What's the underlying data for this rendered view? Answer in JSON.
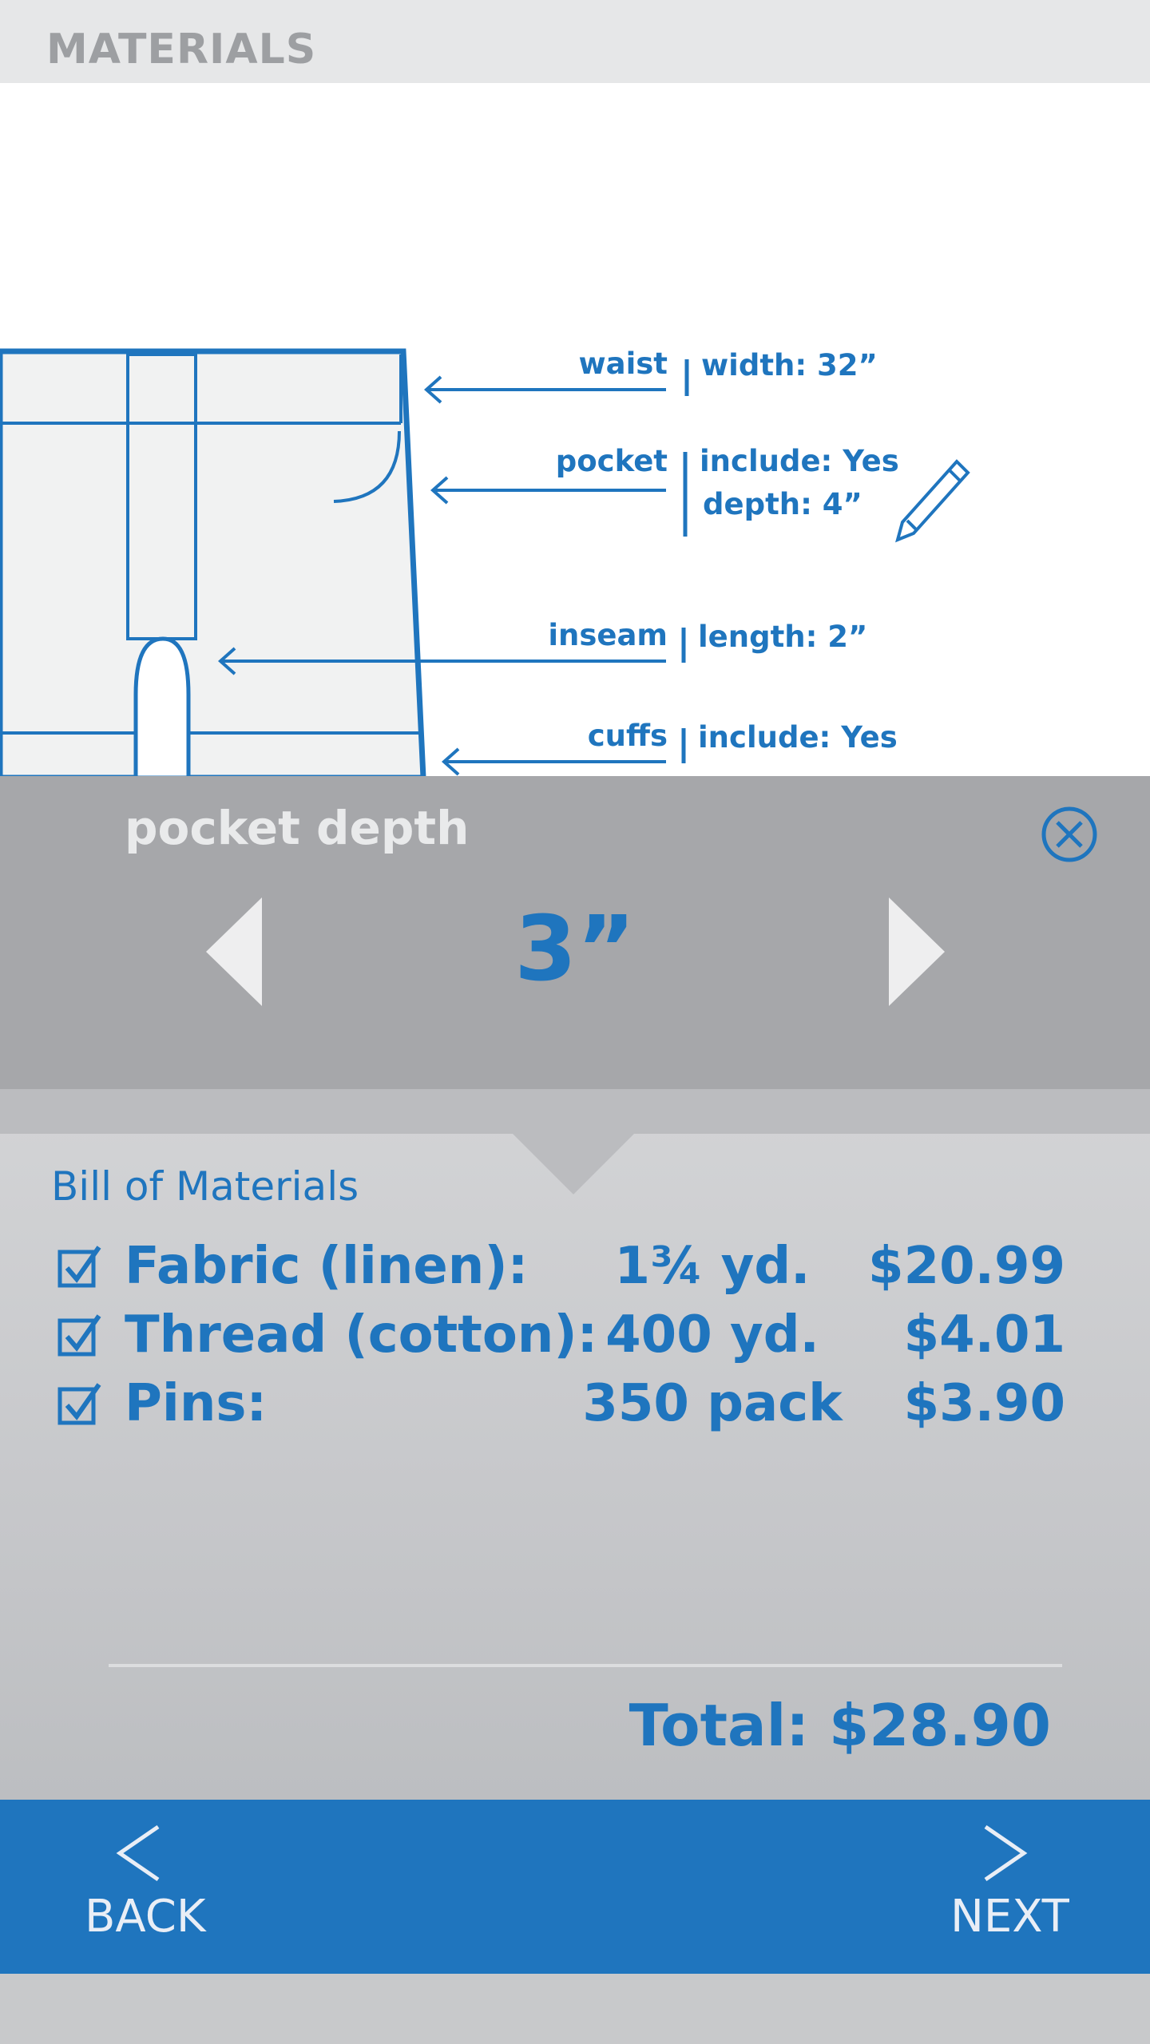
{
  "header": {
    "title": "MATERIALS"
  },
  "diagram": {
    "callouts": [
      {
        "name": "waist",
        "details": [
          "width: 32”"
        ]
      },
      {
        "name": "pocket",
        "details": [
          "include: Yes",
          "depth: 4”"
        ]
      },
      {
        "name": "inseam",
        "details": [
          "length: 2”"
        ]
      },
      {
        "name": "cuffs",
        "details": [
          "include: Yes"
        ]
      }
    ]
  },
  "picker": {
    "title": "pocket depth",
    "value": "3”"
  },
  "bill": {
    "title": "Bill of Materials",
    "items": [
      {
        "name": "Fabric (linen):",
        "qty": "1¾ yd.",
        "price": "$20.99",
        "checked": true
      },
      {
        "name": "Thread (cotton):",
        "qty": "400 yd.",
        "price": "$4.01",
        "checked": true
      },
      {
        "name": "Pins:",
        "qty": "350 pack",
        "price": "$3.90",
        "checked": true
      }
    ],
    "total": "Total: $28.90"
  },
  "footer": {
    "back_label": "BACK",
    "next_label": "NEXT"
  },
  "colors": {
    "accent": "#1f75be",
    "header_bg": "#e6e7e8",
    "picker_bg": "#a6a7aa",
    "footer_bg": "#1f75be"
  },
  "icons": [
    "edit-pencil-icon",
    "close-circle-icon",
    "chevron-left-icon",
    "chevron-right-icon",
    "checkbox-checked-icon"
  ]
}
